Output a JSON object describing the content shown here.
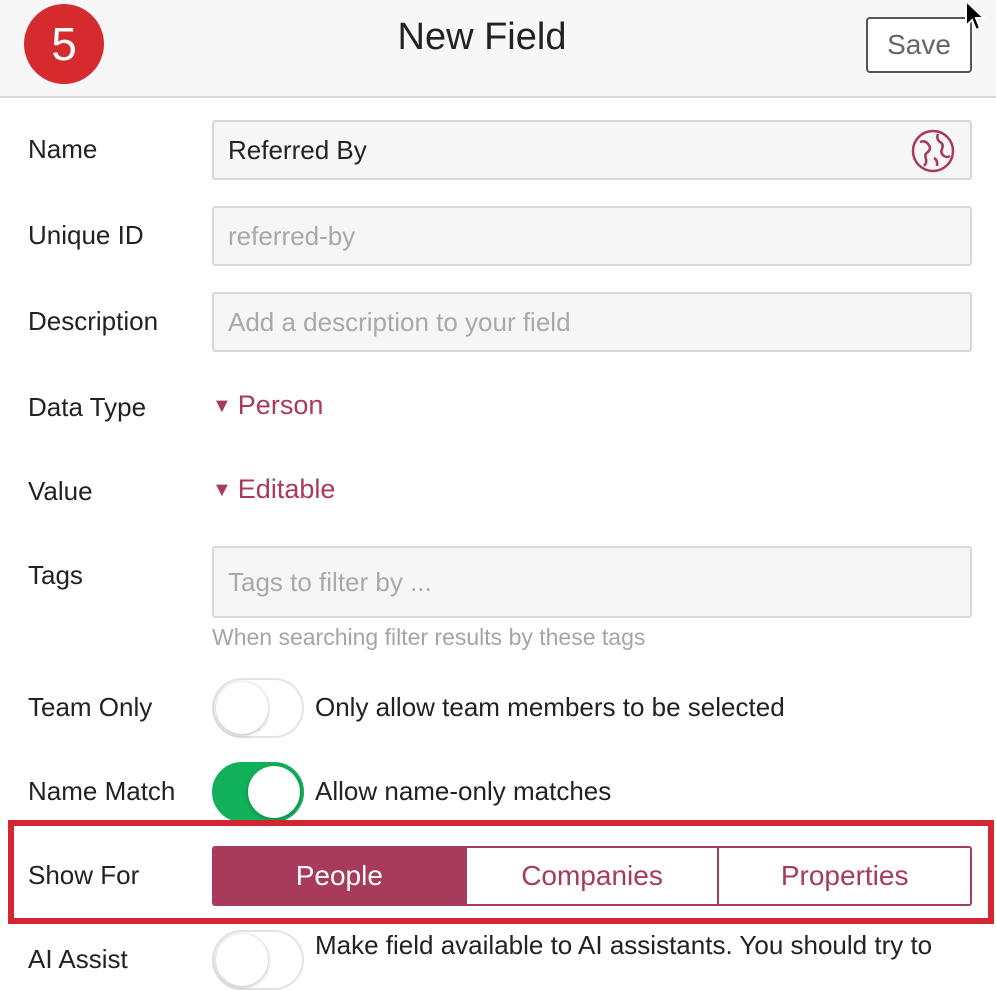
{
  "header": {
    "step_number": "5",
    "title": "New Field",
    "save_label": "Save"
  },
  "form": {
    "name": {
      "label": "Name",
      "value": "Referred By"
    },
    "unique_id": {
      "label": "Unique ID",
      "value": "referred-by"
    },
    "description": {
      "label": "Description",
      "placeholder": "Add a description to your field"
    },
    "data_type": {
      "label": "Data Type",
      "value": "Person"
    },
    "value": {
      "label": "Value",
      "value": "Editable"
    },
    "tags": {
      "label": "Tags",
      "placeholder": "Tags to filter by ...",
      "help": "When searching filter results by these tags"
    },
    "team_only": {
      "label": "Team Only",
      "enabled": false,
      "text": "Only allow team members to be selected"
    },
    "name_match": {
      "label": "Name Match",
      "enabled": true,
      "text": "Allow name-only matches"
    },
    "show_for": {
      "label": "Show For",
      "options": [
        "People",
        "Companies",
        "Properties"
      ],
      "selected": "People"
    },
    "ai_assist": {
      "label": "AI Assist",
      "enabled": false,
      "text": "Make field available to AI assistants. You should try to"
    }
  },
  "colors": {
    "accent": "#a83a5c",
    "toggle_on": "#10b15a",
    "highlight": "#d42630",
    "badge": "#d52b2f"
  },
  "icons": [
    "globe-icon",
    "cursor-icon",
    "caret-down-icon"
  ]
}
